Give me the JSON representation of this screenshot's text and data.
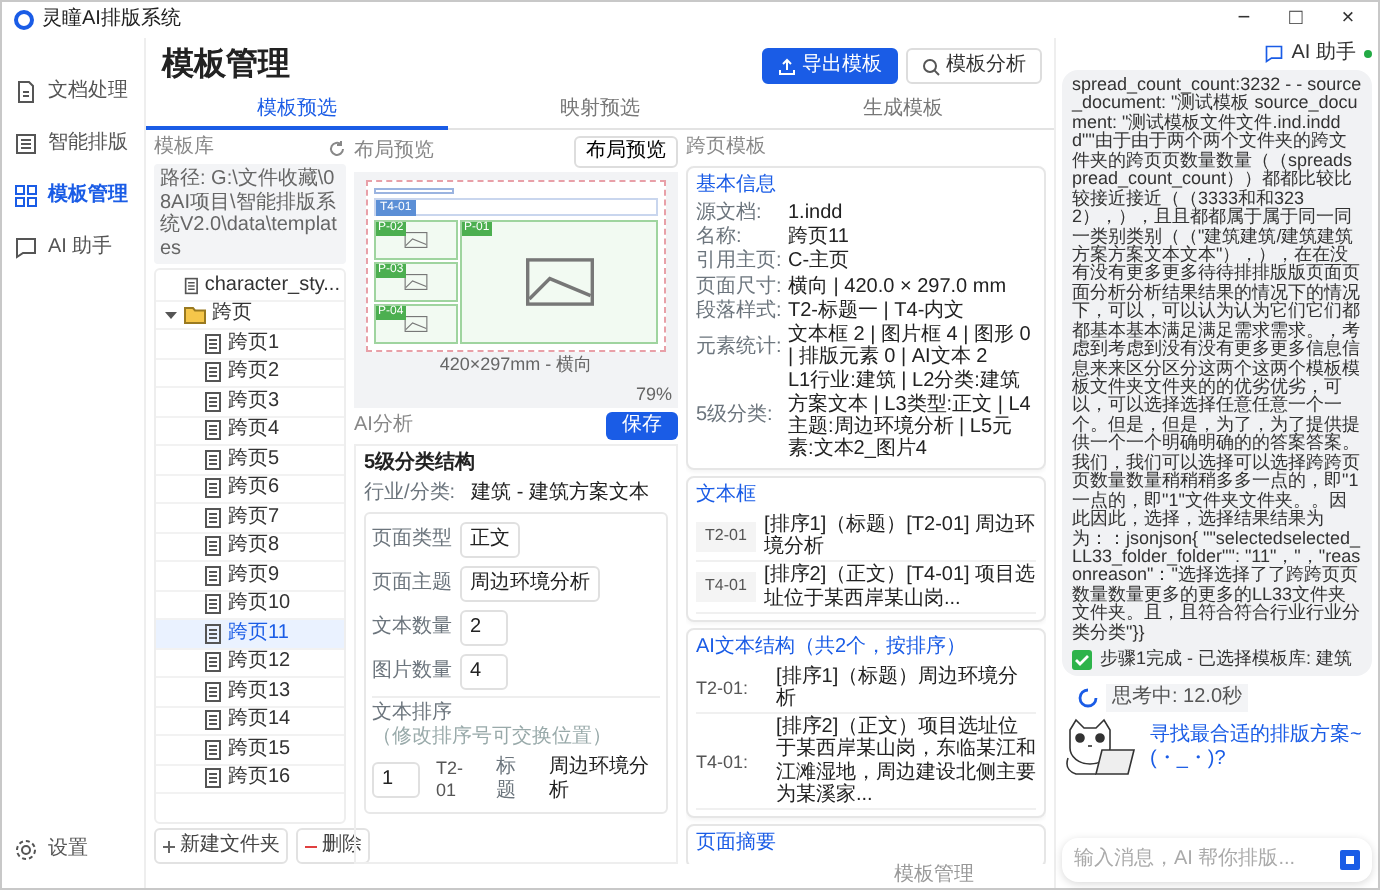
{
  "window": {
    "title": "灵瞳AI排版系统",
    "controls": [
      "−",
      "□",
      "×"
    ]
  },
  "nav": {
    "items": [
      {
        "label": "文档处理",
        "kind": "doc",
        "selected": false
      },
      {
        "label": "智能排版",
        "kind": "layout",
        "selected": false
      },
      {
        "label": "模板管理",
        "kind": "grid",
        "selected": true
      },
      {
        "label": "AI 助手",
        "kind": "chat",
        "selected": false
      }
    ],
    "settings": "设置"
  },
  "page": {
    "title": "模板管理",
    "buttons": [
      {
        "label": "导出模板",
        "kind": "primary"
      },
      {
        "label": "模板分析",
        "kind": "secondary"
      }
    ]
  },
  "tabs": [
    {
      "label": "模板预选",
      "selected": true
    },
    {
      "label": "映射预选",
      "selected": false
    },
    {
      "label": "生成模板",
      "selected": false
    }
  ],
  "library": {
    "title": "模板库",
    "path": "路径: G:\\文件收藏\\08AI项目\\智能排版系统V2.0\\data\\templates",
    "tree": [
      {
        "label": "character_sty...",
        "kind": "file",
        "selected": false
      },
      {
        "label": "跨页",
        "kind": "folder",
        "expanded": true,
        "selected": false,
        "children": [
          {
            "label": "跨页1",
            "kind": "file",
            "selected": false
          },
          {
            "label": "跨页2",
            "kind": "file",
            "selected": false
          },
          {
            "label": "跨页3",
            "kind": "file",
            "selected": false
          },
          {
            "label": "跨页4",
            "kind": "file",
            "selected": false
          },
          {
            "label": "跨页5",
            "kind": "file",
            "selected": false
          },
          {
            "label": "跨页6",
            "kind": "file",
            "selected": false
          },
          {
            "label": "跨页7",
            "kind": "file",
            "selected": false
          },
          {
            "label": "跨页8",
            "kind": "file",
            "selected": false
          },
          {
            "label": "跨页9",
            "kind": "file",
            "selected": false
          },
          {
            "label": "跨页10",
            "kind": "file",
            "selected": false
          },
          {
            "label": "跨页11",
            "kind": "file",
            "selected": true
          },
          {
            "label": "跨页12",
            "kind": "file",
            "selected": false
          },
          {
            "label": "跨页13",
            "kind": "file",
            "selected": false
          },
          {
            "label": "跨页14",
            "kind": "file",
            "selected": false
          },
          {
            "label": "跨页15",
            "kind": "file",
            "selected": false
          },
          {
            "label": "跨页16",
            "kind": "file",
            "selected": false
          }
        ]
      }
    ],
    "buttons": [
      {
        "label": "新建文件夹",
        "kind": "add"
      },
      {
        "label": "删除",
        "kind": "delete"
      }
    ]
  },
  "layout_preview": {
    "title": "布局预览",
    "button": "布局预览",
    "text_frames": [
      {
        "label": "T4-01"
      }
    ],
    "image_frames": [
      {
        "label": "P-02",
        "kind": "small"
      },
      {
        "label": "P-01",
        "kind": "large"
      },
      {
        "label": "P-03",
        "kind": "small"
      },
      {
        "label": "P-04",
        "kind": "small"
      }
    ],
    "caption": "420×297mm - 横向",
    "zoom": "79%"
  },
  "ai_analysis": {
    "title": "AI分析",
    "save": "保存",
    "heading": "5级分类结构",
    "industry_label": "行业/分类:",
    "industry": "建筑 - 建筑方案文本",
    "fields": [
      {
        "label": "页面类型",
        "value": "正文"
      },
      {
        "label": "页面主题",
        "value": "周边环境分析"
      },
      {
        "label": "文本数量",
        "value": "2"
      },
      {
        "label": "图片数量",
        "value": "4"
      }
    ],
    "sort_label": "文本排序",
    "sort_hint": "（修改排序号可交换位置）",
    "sort_rows": [
      {
        "order": "1",
        "id": "T2-01",
        "type": "标题",
        "text": "周边环境分析"
      }
    ]
  },
  "spread_template": {
    "title": "跨页模板",
    "basic": {
      "title": "基本信息",
      "rows": [
        {
          "label": "源文档:",
          "value": "1.indd"
        },
        {
          "label": "名称:",
          "value": "跨页11"
        },
        {
          "label": "引用主页:",
          "value": "C-主页"
        },
        {
          "label": "页面尺寸:",
          "value": "横向 | 420.0 × 297.0 mm"
        },
        {
          "label": "段落样式:",
          "value": "T2-标题一 | T4-内文"
        },
        {
          "label": "元素统计:",
          "value": "文本框 2 | 图片框 4 | 图形 0 | 排版元素 0 | AI文本 2"
        },
        {
          "label": "5级分类:",
          "value": "L1行业:建筑 | L2分类:建筑方案文本 | L3类型:正文 | L4主题:周边环境分析 | L5元素:文本2_图片4"
        }
      ]
    },
    "text_frames": {
      "title": "文本框",
      "items": [
        {
          "id": "T2-01",
          "text": "[排序1]（标题）[T2-01] 周边环境分析"
        },
        {
          "id": "T4-01",
          "text": "[排序2]（正文）[T4-01] 项目选址位于某西岸某山岗..."
        }
      ]
    },
    "ai_structure": {
      "title": "AI文本结构（共2个，按排序）",
      "items": [
        {
          "id": "T2-01:",
          "text": "[排序1]（标题）周边环境分析"
        },
        {
          "id": "T4-01:",
          "text": "[排序2]（正文）项目选址位于某西岸某山岗，东临某江和江滩湿地，周边建设北侧主要为某溪家..."
        }
      ]
    },
    "summary": {
      "title": "页面摘要"
    }
  },
  "footer": "模板管理",
  "assistant": {
    "title": "AI 助手",
    "online": true,
    "message": "spread_count_count:3232 - - source_document: \"测试模板 source_document: \"测试模板文件文件.ind.inddd\"\"由于由于两个两个文件夹的跨文件夹的跨页页数量数量（（spreadspread_count_count））都都比较比较接近接近（（3333和和3232），），且且都都属于属于同一同一类别类别（（\"建筑建筑/建筑建筑方案方案文本文本\"），），在在没有没有更多更多待待排排版版页面页面分析分析结果结果的情况下的情况下，可以，可以认为认为它们它们都都基本基本满足满足需求需求。，考虑到考虑到没有没有更多更多信息信息来来区分区分这两个这两个模板模板文件夹文件夹的的优劣优劣，可以，可以选择选择任意任意一个一个。但是，但是，为了，为了提供提供一个一个明确明确的的答案答案。我们，我们可以选择可以选择跨跨页页数量数量稍稍稍多多一点的，即\"1一点的，即\"1\"文件夹文件夹。。因此因此，选择，选择结果结果为为：：jsonjson{ \"\"selectedselected_LL33_folder_folder\"\": \"11\"，\"，\"reasonreason\"：\"选择选择了了跨跨页页数量数量更多的更多的LL33文件夹文件夹。且，且符合符合行业行业分类分类\"}}",
    "step": "步骤1完成 - 已选择模板库: 建筑",
    "thinking": "思考中: 12.0秒",
    "prompt": "寻找最合适的排版方案~(・_・)?",
    "input_placeholder": "输入消息，AI 帮你排版..."
  }
}
